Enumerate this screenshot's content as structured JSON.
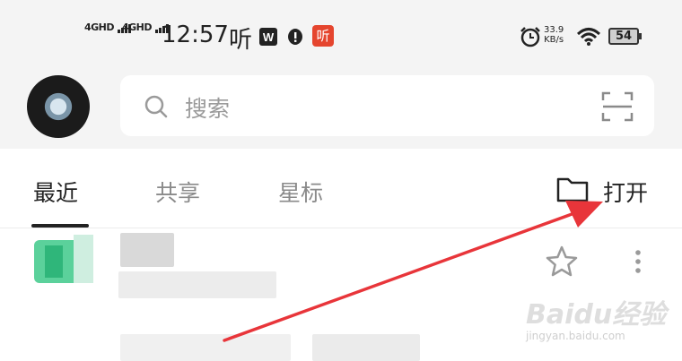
{
  "status_bar": {
    "network_1": "4GHD",
    "network_2": "4GHD",
    "time": "12:57",
    "listen_glyph": "听",
    "listen_badge": "听",
    "speed_value": "33.9",
    "speed_unit": "KB/s",
    "battery": "54",
    "icons": [
      "wps-icon",
      "alert-icon",
      "alarm-icon",
      "wifi-icon",
      "battery-icon"
    ]
  },
  "header": {
    "avatar": "user-avatar",
    "search": {
      "placeholder": "搜索"
    }
  },
  "tabs": [
    {
      "label": "最近",
      "active": true
    },
    {
      "label": "共享",
      "active": false
    },
    {
      "label": "星标",
      "active": false
    }
  ],
  "open_button": {
    "label": "打开"
  },
  "annotation": {
    "arrow_color": "#e8353a"
  },
  "watermark": {
    "logo": "Baidu经验",
    "sub": "jingyan.baidu.com"
  },
  "colors": {
    "accent": "#e8353a",
    "thumb": "#3ec98a",
    "badge": "#e5452e",
    "wps": "#222222"
  }
}
